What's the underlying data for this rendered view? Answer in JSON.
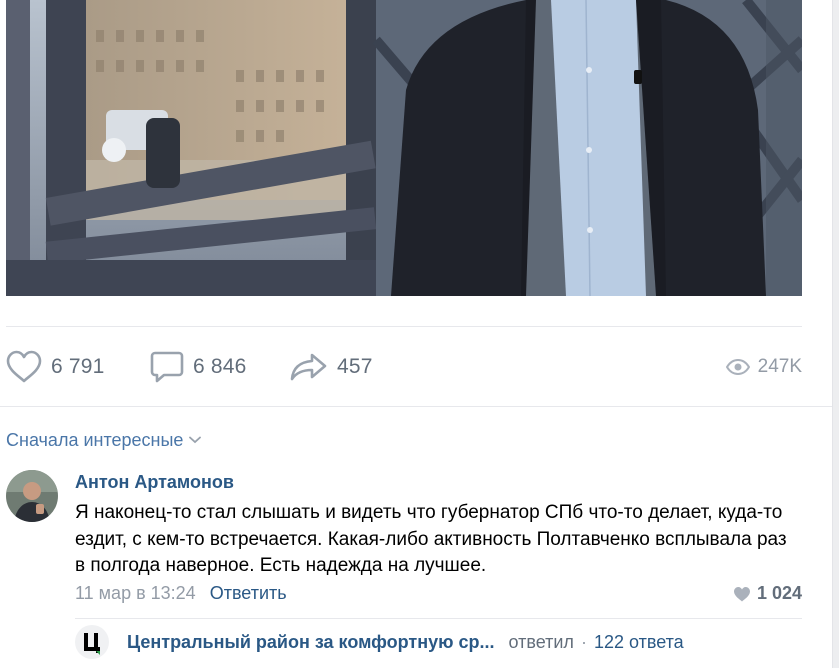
{
  "actions": {
    "likes": "6 791",
    "comments": "6 846",
    "shares": "457",
    "views": "247K"
  },
  "sort": {
    "label": "Сначала интересные"
  },
  "comment": {
    "author": "Антон Артамонов",
    "text": "Я наконец-то стал слышать и видеть что губернатор СПб что-то делает, куда-то ездит, с кем-то встречается. Какая-либо активность Полтавченко всплывала раз в полгода наверное. Есть надежда на лучшее.",
    "date": "11 мар в 13:24",
    "reply_label": "Ответить",
    "likes": "1 024"
  },
  "replies": {
    "author": "Центральный район за комфортную ср...",
    "verb": "ответил",
    "separator": "·",
    "count": "122 ответа"
  },
  "icons": {
    "like": "heart-icon",
    "comment": "speech-bubble-icon",
    "share": "share-arrow-icon",
    "views": "eye-icon",
    "sort": "chevron-down-icon"
  },
  "colors": {
    "link": "#2a5885",
    "accent": "#4a76a8",
    "secondary": "#626d7a",
    "muted": "#939ba6"
  }
}
